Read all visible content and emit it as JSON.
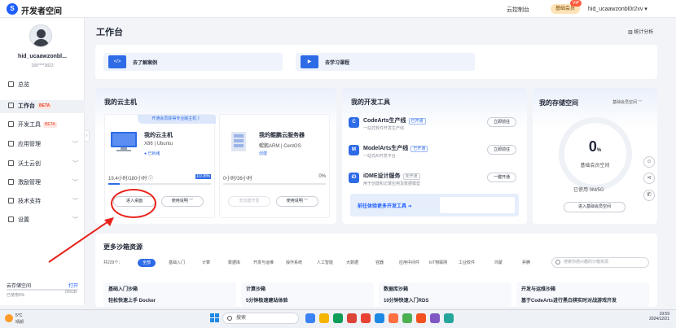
{
  "topbar": {
    "logo_letter": "S",
    "app_name": "开发者空间",
    "console": "云控制台",
    "member": "基础会员",
    "member_badge": "VIP",
    "user": "hid_ucaawzonbl0r2xv ▾"
  },
  "sidebar": {
    "username": "hid_ucaawzonbl...",
    "phone": "180****3822",
    "items": [
      {
        "label": "总览"
      },
      {
        "label": "工作台",
        "tag": "BETA"
      },
      {
        "label": "开发工具",
        "tag": "BETA"
      },
      {
        "label": "应用管理"
      },
      {
        "label": "沃土云创"
      },
      {
        "label": "激励管理"
      },
      {
        "label": "技术支持"
      },
      {
        "label": "设置"
      }
    ],
    "cloud_storage": {
      "label": "云存储空间",
      "action": "打开",
      "total": "0/5GB",
      "usage": "已使用0%"
    }
  },
  "main": {
    "title": "工作台",
    "stats": "统计分析",
    "banner": {
      "case": "去了解案例",
      "course": "去学习课程"
    },
    "vm_section": {
      "title": "我的云主机",
      "promo": "开通会员获得专业版主机 〉",
      "hosts": [
        {
          "name": "我的云主机",
          "os": "X86 | Ubuntu",
          "state": "● 已就绪",
          "usage": "19.4小时/180小时 ⓘ",
          "percent": "10.8%",
          "fill": 0.108,
          "primary": "进入桌面",
          "guide": "使用说明 ﹀"
        },
        {
          "name": "我的鲲鹏云服务器",
          "os": "鲲鹏ARM | CentOS",
          "state": "创建",
          "usage": "0小时/36小时",
          "percent": "0%",
          "fill": 0,
          "primary": "去创建开发",
          "guide": "使用说明 ﹀"
        }
      ]
    },
    "tools_section": {
      "title": "我的开发工具",
      "tools": [
        {
          "icon": "C",
          "name": "CodeArts生产线",
          "tag": "已开通",
          "desc": "一站式软件开发生产线",
          "action": "立即前往"
        },
        {
          "icon": "M",
          "name": "ModelArts生产线",
          "tag": "已开通",
          "desc": "一站式AI开发平台",
          "action": "立即前往"
        },
        {
          "icon": "iD",
          "name": "iDME设计服务",
          "tag": "未开通",
          "desc": "用于创建和记录应用及数据模型",
          "action": "一键开通"
        }
      ],
      "more": "前往体验更多开发工具 ➜"
    },
    "storage_section": {
      "title": "我的存储空间",
      "select": "基础会员空间 ﹀",
      "value": "0",
      "unit": "%",
      "label": "基础会员空间",
      "used": "已使用   0M/5G",
      "action": "进入基础会员空间"
    },
    "sandbox": {
      "title": "更多沙箱资源",
      "total": "共229个：",
      "chips": [
        "全部",
        "基础入门",
        "计算",
        "数据库",
        "开发与运维",
        "操作系统",
        "人工智能",
        "大数据",
        "容器",
        "应用中间件",
        "IoT物联网",
        "工业软件",
        "鸿蒙",
        "昇腾"
      ],
      "search_placeholder": "搜索你感兴趣的沙箱资源",
      "cards": [
        {
          "header": "基础入门沙箱",
          "title": "轻松快速上手 Docker"
        },
        {
          "header": "计算沙箱",
          "title": "5分钟极速建站体验"
        },
        {
          "header": "数据库沙箱",
          "title": "10分钟快速入门RDS"
        },
        {
          "header": "开发与运维沙箱",
          "title": "基于CodeArts进行黑白棋实时对战游戏开发"
        }
      ]
    }
  },
  "taskbar": {
    "temp": "5°C",
    "weather": "晴朗",
    "search": "搜索",
    "time": "19:59",
    "date": "2024/12/21"
  },
  "colors": {
    "primary": "#2e6be6",
    "annotation": "#e8231a",
    "tag_red": "#e5432b"
  }
}
